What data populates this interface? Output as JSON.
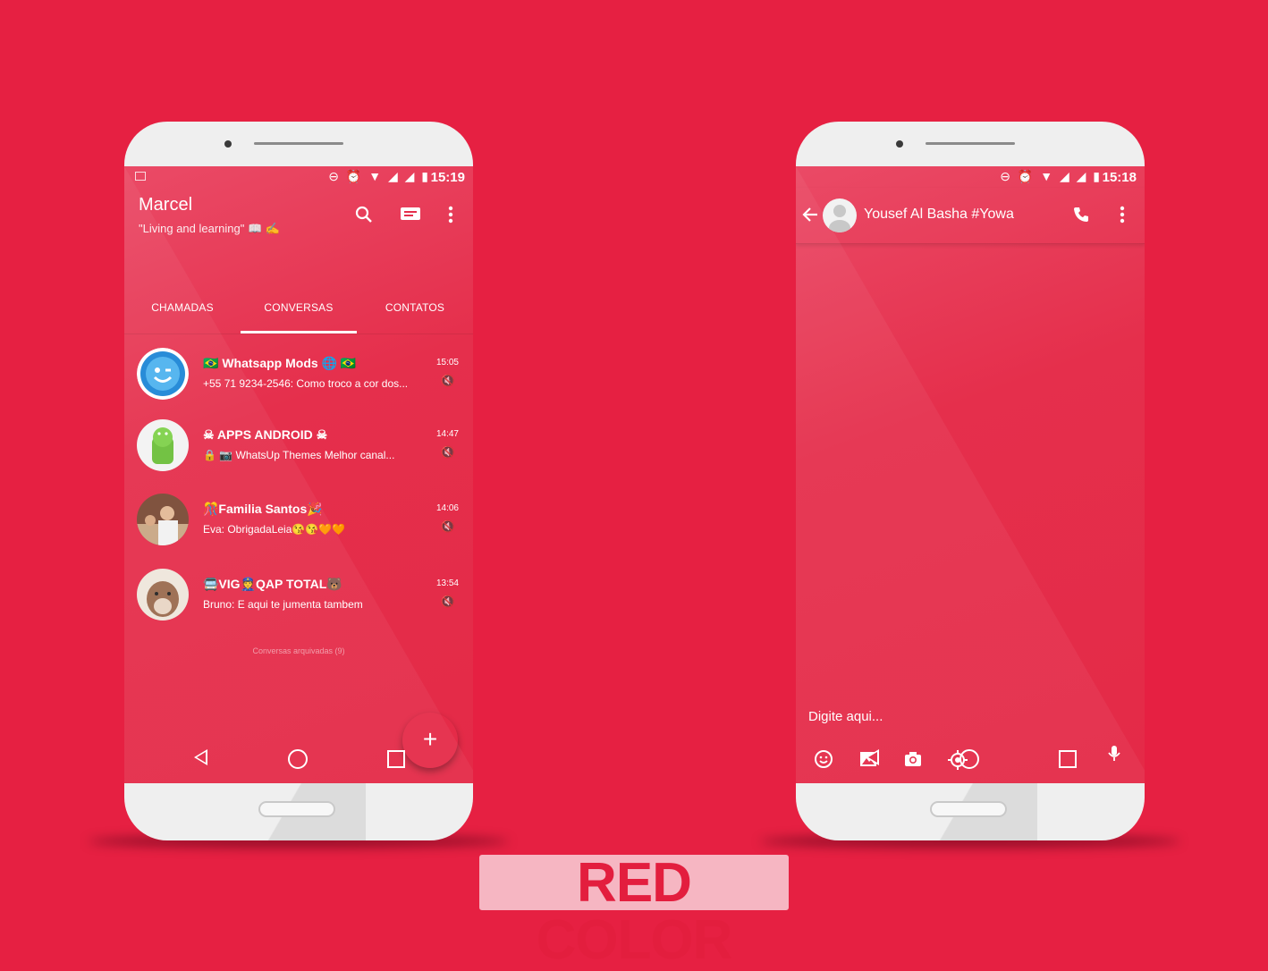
{
  "left_phone": {
    "status_time": "15:19",
    "status_icons": "⊖ ⏰ ▼ ◢ ◢ ▮",
    "title": "Marcel",
    "subtitle": "\"Living and learning\" 📖 ✍",
    "tabs": [
      "CHAMADAS",
      "CONVERSAS",
      "CONTATOS"
    ],
    "chats": [
      {
        "name": "🇧🇷 Whatsapp Mods 🌐 🇧🇷",
        "message": "+55 71 9234-2546: Como troco a cor dos...",
        "time": "15:05"
      },
      {
        "name": "☠ APPS ANDROID ☠",
        "message": "🔒 📷 WhatsUp Themes Melhor canal...",
        "time": "14:47"
      },
      {
        "name": "🎊Familia Santos🎉",
        "message": "Eva: ObrigadaLeia😘😘🧡🧡",
        "time": "14:06"
      },
      {
        "name": "🚍VIG👮QAP TOTAL🐻",
        "message": "Bruno: E aqui te jumenta tambem",
        "time": "13:54"
      }
    ],
    "archived": "Conversas arquivadas (9)",
    "fab": "+"
  },
  "right_phone": {
    "status_time": "15:18",
    "status_icons": "⊖ ⏰ ▼ ◢ ◢ ▮",
    "contact_name": "Yousef Al Basha #Yowa",
    "composer_placeholder": "Digite aqui..."
  },
  "badge": "RED COLOR",
  "colors": {
    "background": "#e62042",
    "screen": "#e52f4c",
    "badge_bg": "#f6b6c2",
    "badge_text": "#e31e3e"
  }
}
